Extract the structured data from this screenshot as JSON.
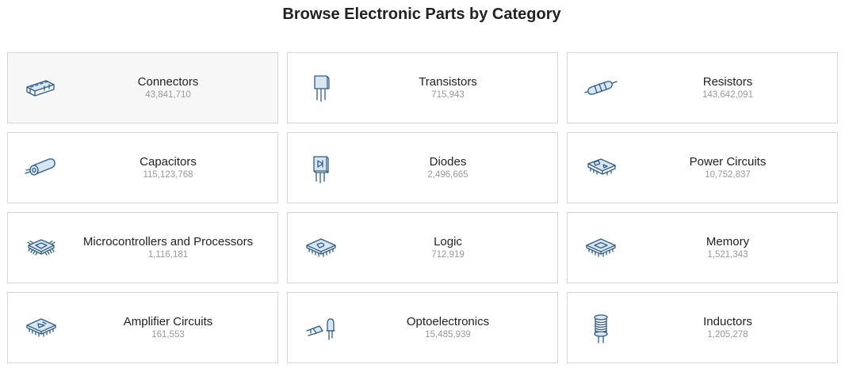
{
  "page": {
    "title": "Browse Electronic Parts by Category"
  },
  "categories": [
    {
      "name": "Connectors",
      "count": "43,841,710",
      "icon": "connector-icon"
    },
    {
      "name": "Transistors",
      "count": "715,943",
      "icon": "transistor-icon"
    },
    {
      "name": "Resistors",
      "count": "143,642,091",
      "icon": "resistor-icon"
    },
    {
      "name": "Capacitors",
      "count": "115,123,768",
      "icon": "capacitor-icon"
    },
    {
      "name": "Diodes",
      "count": "2,496,665",
      "icon": "diode-icon"
    },
    {
      "name": "Power Circuits",
      "count": "10,752,837",
      "icon": "power-circuit-icon"
    },
    {
      "name": "Microcontrollers and Processors",
      "count": "1,116,181",
      "icon": "microcontroller-icon"
    },
    {
      "name": "Logic",
      "count": "712,919",
      "icon": "logic-chip-icon"
    },
    {
      "name": "Memory",
      "count": "1,521,343",
      "icon": "memory-chip-icon"
    },
    {
      "name": "Amplifier Circuits",
      "count": "161,553",
      "icon": "amplifier-chip-icon"
    },
    {
      "name": "Optoelectronics",
      "count": "15,485,939",
      "icon": "led-icon"
    },
    {
      "name": "Inductors",
      "count": "1,205,278",
      "icon": "inductor-icon"
    }
  ],
  "colors": {
    "icon_stroke": "#2f5d86",
    "hover_background": "#f7f7f7",
    "border": "#d6d6d6"
  }
}
